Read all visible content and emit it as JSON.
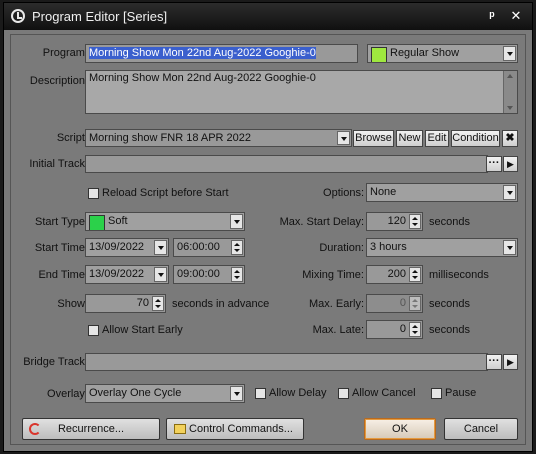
{
  "window": {
    "title": "Program Editor [Series]",
    "pin_glyph": "ᵖ",
    "close_glyph": "✕"
  },
  "program": {
    "label": "Program:",
    "value": "Morning Show Mon 22nd Aug-2022 Googhie-0",
    "type_value": "Regular Show",
    "type_color": "#9fe83f"
  },
  "description": {
    "label": "Description:",
    "value": "Morning Show Mon 22nd Aug-2022 Googhie-0"
  },
  "script": {
    "label": "Script:",
    "value": "Morning show FNR 18 APR 2022",
    "browse": "Browse",
    "new": "New",
    "edit": "Edit",
    "condition": "Condition",
    "clear": "✖"
  },
  "initial_track": {
    "label": "Initial Track:",
    "value": "",
    "dots": "···",
    "play": "▶"
  },
  "reload": {
    "label": "Reload Script before Start",
    "checked": false
  },
  "options": {
    "label": "Options:",
    "value": "None"
  },
  "start_type": {
    "label": "Start Type:",
    "value": "Soft",
    "color": "#2bd14a"
  },
  "max_start_delay": {
    "label": "Max. Start Delay:",
    "value": "120",
    "unit": "seconds"
  },
  "start_time": {
    "label": "Start Time:",
    "date": "13/09/2022",
    "time": "06:00:00"
  },
  "duration": {
    "label": "Duration:",
    "value": "3 hours"
  },
  "end_time": {
    "label": "End Time:",
    "date": "13/09/2022",
    "time": "09:00:00"
  },
  "mixing_time": {
    "label": "Mixing Time:",
    "value": "200",
    "unit": "milliseconds"
  },
  "show": {
    "label": "Show:",
    "value": "70",
    "unit": "seconds in advance"
  },
  "max_early": {
    "label": "Max. Early:",
    "value": "0",
    "unit": "seconds"
  },
  "allow_start_early": {
    "label": "Allow Start Early",
    "checked": false
  },
  "max_late": {
    "label": "Max. Late:",
    "value": "0",
    "unit": "seconds"
  },
  "bridge_track": {
    "label": "Bridge Track:",
    "value": "",
    "dots": "···",
    "play": "▶"
  },
  "overlay": {
    "label": "Overlay:",
    "value": "Overlay One Cycle"
  },
  "allow_delay": {
    "label": "Allow Delay",
    "checked": false
  },
  "allow_cancel": {
    "label": "Allow Cancel",
    "checked": false
  },
  "pause": {
    "label": "Pause",
    "checked": false
  },
  "buttons": {
    "recurrence": "Recurrence...",
    "control_commands": "Control Commands...",
    "ok": "OK",
    "cancel": "Cancel"
  }
}
